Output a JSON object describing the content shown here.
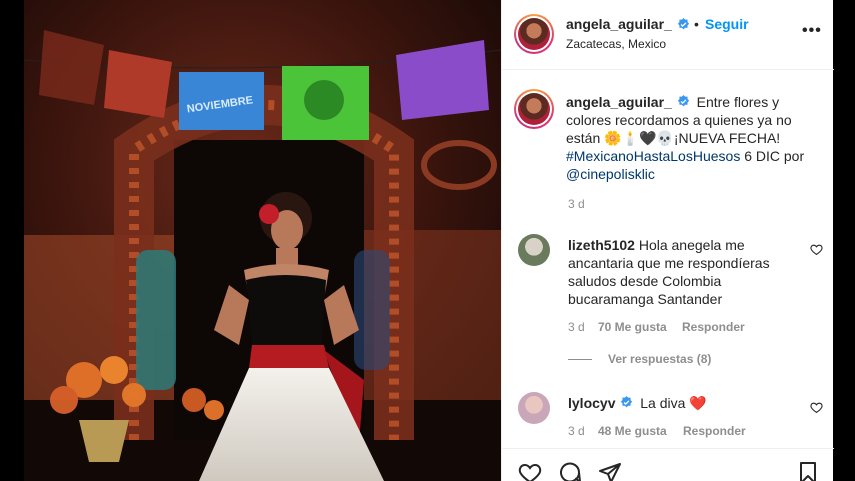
{
  "post": {
    "username": "angela_aguilar_",
    "follow_label": "Seguir",
    "separator": "•",
    "location": "Zacatecas, Mexico",
    "more_label": "•••"
  },
  "caption": {
    "username": "angela_aguilar_",
    "text_before": "Entre flores y colores recordamos a quienes ya no están",
    "emojis": "🌼🕯️🖤💀",
    "text_after": "¡NUEVA FECHA!",
    "hashtag": "#MexicanoHastaLosHuesos",
    "date_text": "6 DIC por",
    "mention": "@cinepolisklic",
    "time": "3 d"
  },
  "comments": [
    {
      "username": "lizeth5102",
      "text": "Hola anegela me ancantaria que me respondíeras saludos desde Colombia bucaramanga Santander",
      "time": "3 d",
      "likes": "70 Me gusta",
      "reply_label": "Responder",
      "view_replies": "Ver respuestas (8)"
    },
    {
      "username": "lylocyv",
      "text": "La diva",
      "emoji": "❤️",
      "time": "3 d",
      "likes": "48 Me gusta",
      "reply_label": "Responder"
    }
  ],
  "photo": {
    "banner_text": "NOVIEMBRE"
  },
  "icons": {
    "like": "heart-icon",
    "comment": "comment-icon",
    "share": "share-icon",
    "save": "bookmark-icon",
    "verified": "verified-badge-icon"
  },
  "colors": {
    "link_blue": "#0095f6",
    "tag_blue": "#00376b",
    "verified_blue": "#3897f0",
    "muted": "#8e8e8e",
    "text": "#262626"
  }
}
